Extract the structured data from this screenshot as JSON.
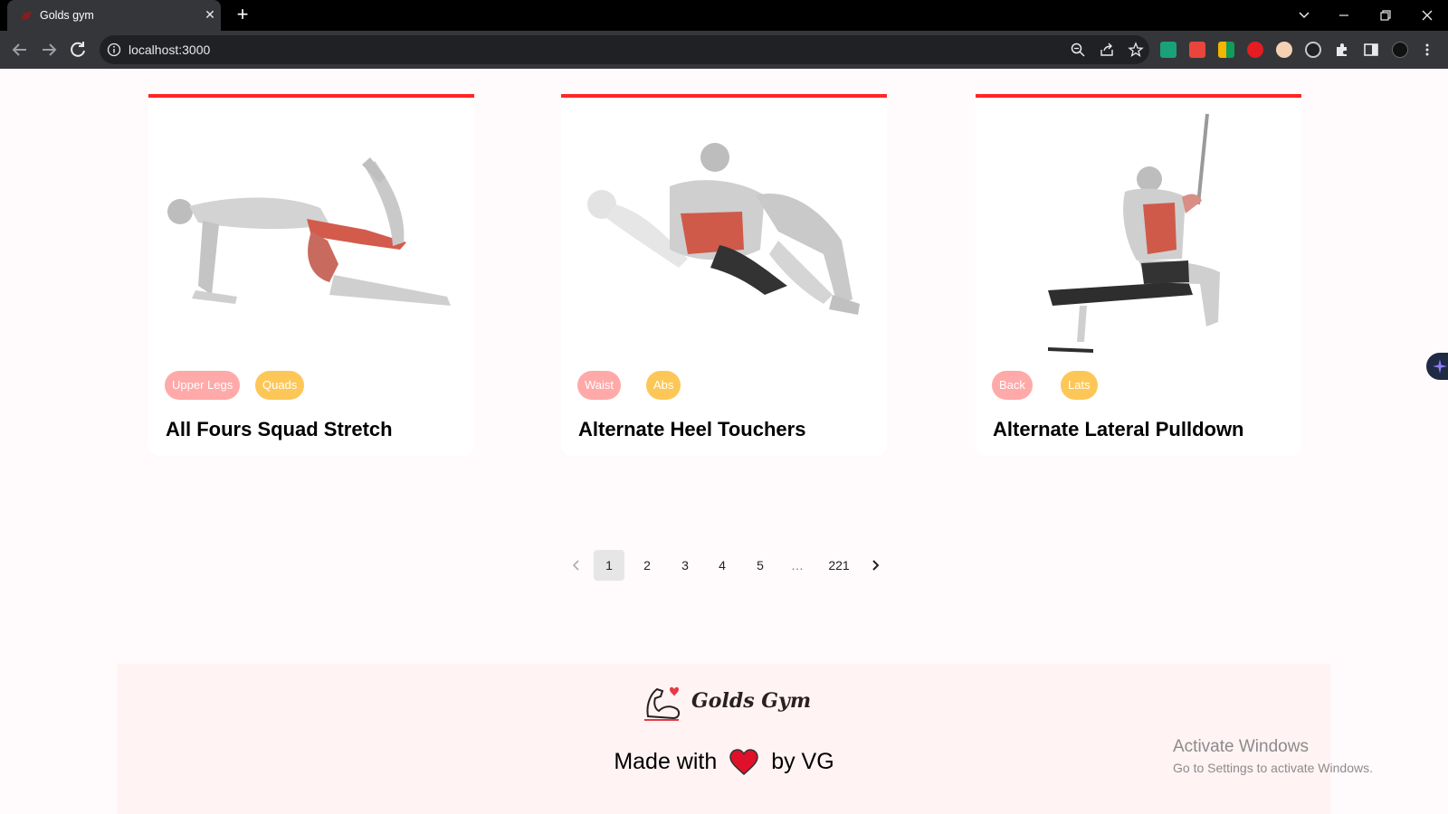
{
  "browser": {
    "tab_title": "Golds gym",
    "tab_close": "✕",
    "new_tab": "+",
    "url": "localhost:3000"
  },
  "exercises": [
    {
      "name": "All Fours Squad Stretch",
      "body_part": "Upper Legs",
      "target": "Quads"
    },
    {
      "name": "Alternate Heel Touchers",
      "body_part": "Waist",
      "target": "Abs"
    },
    {
      "name": "Alternate Lateral Pulldown",
      "body_part": "Back",
      "target": "Lats"
    }
  ],
  "pagination": {
    "pages": [
      "1",
      "2",
      "3",
      "4",
      "5",
      "…",
      "221"
    ],
    "current": "1"
  },
  "footer": {
    "logo_text": "Golds Gym",
    "made_with": "Made with",
    "by": "by VG"
  },
  "watermark": {
    "line1": "Activate Windows",
    "line2": "Go to Settings to activate Windows."
  },
  "colors": {
    "accent": "#ff2625",
    "body_part_tag": "#ffa9a9",
    "target_tag": "#fcc757",
    "page_bg": "#fffafb",
    "footer_bg": "#fff3f4"
  }
}
